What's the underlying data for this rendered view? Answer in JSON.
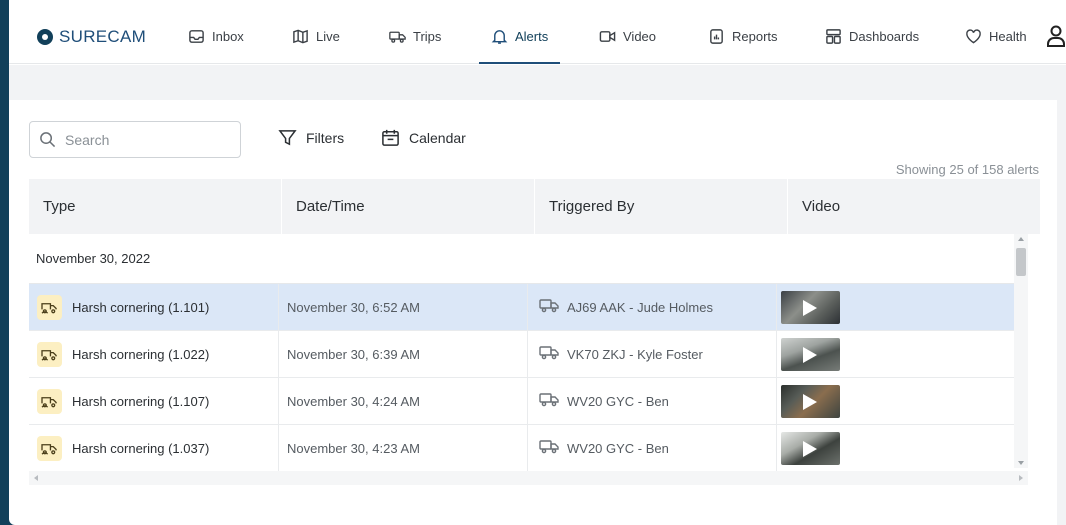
{
  "brand": {
    "name": "SURECAM",
    "color": "#1f4e79"
  },
  "nav": {
    "items": [
      {
        "label": "Inbox",
        "icon": "inbox-icon"
      },
      {
        "label": "Live",
        "icon": "map-icon"
      },
      {
        "label": "Trips",
        "icon": "truck-icon"
      },
      {
        "label": "Alerts",
        "icon": "bell-icon",
        "active": true
      },
      {
        "label": "Video",
        "icon": "video-camera-icon"
      },
      {
        "label": "Reports",
        "icon": "report-icon"
      },
      {
        "label": "Dashboards",
        "icon": "dashboard-icon"
      },
      {
        "label": "Health",
        "icon": "heart-icon"
      }
    ],
    "user_icon": "user-icon"
  },
  "toolbar": {
    "search_placeholder": "Search",
    "filters_label": "Filters",
    "calendar_label": "Calendar",
    "showing_text": "Showing 25 of 158 alerts"
  },
  "table": {
    "columns": [
      "Type",
      "Date/Time",
      "Triggered By",
      "Video"
    ],
    "group_label": "November 30, 2022",
    "rows": [
      {
        "type": "Harsh cornering (1.101)",
        "datetime": "November 30, 6:52 AM",
        "triggered_by": "AJ69 AAK - Jude Holmes",
        "selected": true,
        "video_icon": "video-thumbnail"
      },
      {
        "type": "Harsh cornering (1.022)",
        "datetime": "November 30, 6:39 AM",
        "triggered_by": "VK70 ZKJ - Kyle Foster",
        "selected": false,
        "video_icon": "video-thumbnail"
      },
      {
        "type": "Harsh cornering (1.107)",
        "datetime": "November 30, 4:24 AM",
        "triggered_by": "WV20 GYC - Ben",
        "selected": false,
        "video_icon": "video-thumbnail"
      },
      {
        "type": "Harsh cornering (1.037)",
        "datetime": "November 30, 4:23 AM",
        "triggered_by": "WV20 GYC - Ben",
        "selected": false,
        "video_icon": "video-thumbnail"
      }
    ]
  },
  "colors": {
    "frame": "#12405a",
    "selected_row": "#dbe7f7",
    "alert_badge": "#fcefc2"
  }
}
